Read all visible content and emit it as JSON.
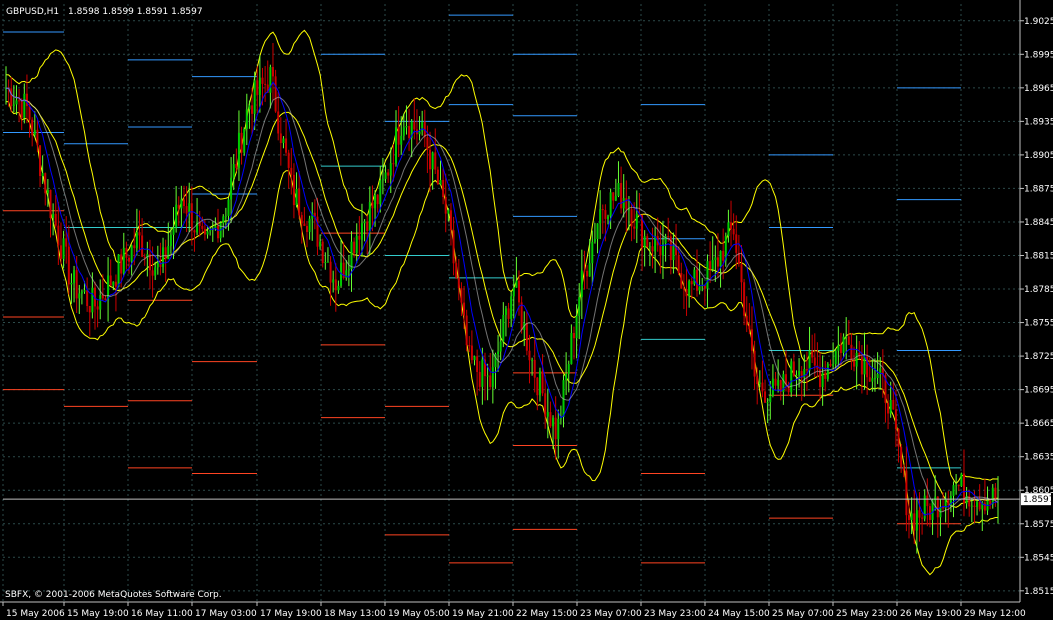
{
  "header": {
    "symbol_label": "GBPUSD,H1",
    "ohlc_text": "1.8598 1.8599 1.8591 1.8597"
  },
  "footer": {
    "copyright": "SBFX, © 2001-2006 MetaQuotes Software Corp."
  },
  "current_price": "1.8597",
  "colors": {
    "background": "#000000",
    "grid": "#2c4a4a",
    "axis": "#c0c0c0",
    "candle_bull": "#00cc00",
    "candle_bear": "#cc0000",
    "wick_bull": "#66ff33",
    "ma_band": "#ffff00",
    "ma_fast": "#0000ff",
    "ma_slow": "#c0c0c0",
    "pivot_high": "#3399ff",
    "pivot_low": "#ff4422",
    "pivot_mid": "#33cccc"
  },
  "chart_data": {
    "type": "candlestick",
    "instrument": "GBPUSD",
    "timeframe": "H1",
    "ylim": [
      1.8505,
      1.904
    ],
    "y_ticks": [
      "1.9025",
      "1.8995",
      "1.8965",
      "1.8935",
      "1.8905",
      "1.8875",
      "1.8845",
      "1.8815",
      "1.8785",
      "1.8755",
      "1.8725",
      "1.8695",
      "1.8665",
      "1.8635",
      "1.8605",
      "1.8575",
      "1.8545",
      "1.8515"
    ],
    "x_ticks": [
      "15 May 2006",
      "15 May 19:00",
      "16 May 11:00",
      "17 May 03:00",
      "17 May 19:00",
      "18 May 13:00",
      "19 May 05:00",
      "19 May 21:00",
      "22 May 15:00",
      "23 May 07:00",
      "23 May 23:00",
      "24 May 15:00",
      "25 May 07:00",
      "25 May 23:00",
      "26 May 19:00",
      "29 May 12:00"
    ],
    "price_anchors": [
      1.8965,
      1.8945,
      1.886,
      1.879,
      1.877,
      1.88,
      1.883,
      1.88,
      1.887,
      1.882,
      1.886,
      1.895,
      1.8975,
      1.887,
      1.884,
      1.879,
      1.884,
      1.887,
      1.894,
      1.892,
      1.885,
      1.872,
      1.87,
      1.879,
      1.871,
      1.8655,
      1.878,
      1.886,
      1.887,
      1.883,
      1.882,
      1.8785,
      1.88,
      1.884,
      1.87,
      1.869,
      1.872,
      1.871,
      1.874,
      1.872,
      1.869,
      1.858,
      1.859,
      1.861,
      1.86,
      1.8597
    ],
    "pivot_levels": [
      {
        "price": 1.9015,
        "from": "15 May 2006",
        "to": "15 May 19:00",
        "kind": "high"
      },
      {
        "price": 1.8925,
        "from": "15 May 2006",
        "to": "15 May 19:00",
        "kind": "high"
      },
      {
        "price": 1.8855,
        "from": "15 May 2006",
        "to": "15 May 19:00",
        "kind": "low"
      },
      {
        "price": 1.876,
        "from": "15 May 2006",
        "to": "15 May 19:00",
        "kind": "low"
      },
      {
        "price": 1.8695,
        "from": "15 May 2006",
        "to": "15 May 19:00",
        "kind": "low"
      },
      {
        "price": 1.8915,
        "from": "15 May 19:00",
        "to": "16 May 11:00",
        "kind": "high"
      },
      {
        "price": 1.884,
        "from": "15 May 19:00",
        "to": "16 May 11:00",
        "kind": "mid"
      },
      {
        "price": 1.868,
        "from": "15 May 19:00",
        "to": "16 May 11:00",
        "kind": "low"
      },
      {
        "price": 1.899,
        "from": "16 May 11:00",
        "to": "17 May 03:00",
        "kind": "high"
      },
      {
        "price": 1.893,
        "from": "16 May 11:00",
        "to": "17 May 03:00",
        "kind": "high"
      },
      {
        "price": 1.884,
        "from": "16 May 11:00",
        "to": "17 May 03:00",
        "kind": "mid"
      },
      {
        "price": 1.8775,
        "from": "16 May 11:00",
        "to": "17 May 03:00",
        "kind": "low"
      },
      {
        "price": 1.8685,
        "from": "16 May 11:00",
        "to": "17 May 03:00",
        "kind": "low"
      },
      {
        "price": 1.8625,
        "from": "16 May 11:00",
        "to": "17 May 03:00",
        "kind": "low"
      },
      {
        "price": 1.8975,
        "from": "17 May 03:00",
        "to": "17 May 19:00",
        "kind": "high"
      },
      {
        "price": 1.887,
        "from": "17 May 03:00",
        "to": "17 May 19:00",
        "kind": "high"
      },
      {
        "price": 1.872,
        "from": "17 May 03:00",
        "to": "17 May 19:00",
        "kind": "low"
      },
      {
        "price": 1.862,
        "from": "17 May 03:00",
        "to": "17 May 19:00",
        "kind": "low"
      },
      {
        "price": 1.8995,
        "from": "18 May 13:00",
        "to": "19 May 05:00",
        "kind": "high"
      },
      {
        "price": 1.8895,
        "from": "18 May 13:00",
        "to": "19 May 05:00",
        "kind": "mid"
      },
      {
        "price": 1.8835,
        "from": "18 May 13:00",
        "to": "19 May 05:00",
        "kind": "low"
      },
      {
        "price": 1.8735,
        "from": "18 May 13:00",
        "to": "19 May 05:00",
        "kind": "low"
      },
      {
        "price": 1.867,
        "from": "18 May 13:00",
        "to": "19 May 05:00",
        "kind": "low"
      },
      {
        "price": 1.8935,
        "from": "19 May 05:00",
        "to": "19 May 21:00",
        "kind": "high"
      },
      {
        "price": 1.8815,
        "from": "19 May 05:00",
        "to": "19 May 21:00",
        "kind": "mid"
      },
      {
        "price": 1.868,
        "from": "19 May 05:00",
        "to": "19 May 21:00",
        "kind": "low"
      },
      {
        "price": 1.8565,
        "from": "19 May 05:00",
        "to": "19 May 21:00",
        "kind": "low"
      },
      {
        "price": 1.903,
        "from": "19 May 21:00",
        "to": "22 May 15:00",
        "kind": "high"
      },
      {
        "price": 1.895,
        "from": "19 May 21:00",
        "to": "22 May 15:00",
        "kind": "high"
      },
      {
        "price": 1.8795,
        "from": "19 May 21:00",
        "to": "22 May 15:00",
        "kind": "mid"
      },
      {
        "price": 1.854,
        "from": "19 May 21:00",
        "to": "22 May 15:00",
        "kind": "low"
      },
      {
        "price": 1.8995,
        "from": "22 May 15:00",
        "to": "23 May 07:00",
        "kind": "high"
      },
      {
        "price": 1.894,
        "from": "22 May 15:00",
        "to": "23 May 07:00",
        "kind": "high"
      },
      {
        "price": 1.885,
        "from": "22 May 15:00",
        "to": "23 May 07:00",
        "kind": "high"
      },
      {
        "price": 1.871,
        "from": "22 May 15:00",
        "to": "23 May 07:00",
        "kind": "low"
      },
      {
        "price": 1.8645,
        "from": "22 May 15:00",
        "to": "23 May 07:00",
        "kind": "low"
      },
      {
        "price": 1.857,
        "from": "22 May 15:00",
        "to": "23 May 07:00",
        "kind": "low"
      },
      {
        "price": 1.895,
        "from": "23 May 23:00",
        "to": "24 May 15:00",
        "kind": "high"
      },
      {
        "price": 1.883,
        "from": "23 May 23:00",
        "to": "24 May 15:00",
        "kind": "high"
      },
      {
        "price": 1.874,
        "from": "23 May 23:00",
        "to": "24 May 15:00",
        "kind": "mid"
      },
      {
        "price": 1.862,
        "from": "23 May 23:00",
        "to": "24 May 15:00",
        "kind": "low"
      },
      {
        "price": 1.854,
        "from": "23 May 23:00",
        "to": "24 May 15:00",
        "kind": "low"
      },
      {
        "price": 1.8905,
        "from": "25 May 07:00",
        "to": "25 May 23:00",
        "kind": "high"
      },
      {
        "price": 1.884,
        "from": "25 May 07:00",
        "to": "25 May 23:00",
        "kind": "high"
      },
      {
        "price": 1.873,
        "from": "25 May 07:00",
        "to": "25 May 23:00",
        "kind": "mid"
      },
      {
        "price": 1.869,
        "from": "25 May 07:00",
        "to": "25 May 23:00",
        "kind": "low"
      },
      {
        "price": 1.858,
        "from": "25 May 07:00",
        "to": "25 May 23:00",
        "kind": "low"
      },
      {
        "price": 1.8965,
        "from": "26 May 19:00",
        "to": "29 May 12:00",
        "kind": "high"
      },
      {
        "price": 1.8865,
        "from": "26 May 19:00",
        "to": "29 May 12:00",
        "kind": "high"
      },
      {
        "price": 1.873,
        "from": "26 May 19:00",
        "to": "29 May 12:00",
        "kind": "high"
      },
      {
        "price": 1.8625,
        "from": "26 May 19:00",
        "to": "29 May 12:00",
        "kind": "mid"
      },
      {
        "price": 1.8575,
        "from": "26 May 19:00",
        "to": "29 May 12:00",
        "kind": "low"
      }
    ]
  }
}
